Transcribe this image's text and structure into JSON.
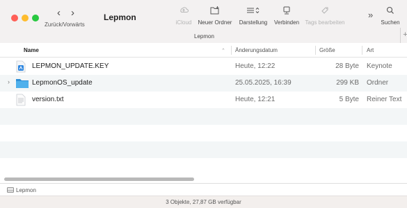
{
  "window": {
    "title": "Lepmon",
    "path_title": "Lepmon"
  },
  "toolbar": {
    "nav_label": "Zurück/Vorwärts",
    "back_icon": "chevron-left-icon",
    "forward_icon": "chevron-right-icon",
    "back_glyph": "‹",
    "forward_glyph": "›",
    "icloud_label": "iCloud",
    "new_folder_label": "Neuer Ordner",
    "view_label": "Darstellung",
    "connect_label": "Verbinden",
    "tags_label": "Tags bearbeiten",
    "more_glyph": "»",
    "search_label": "Suchen",
    "add_glyph": "+"
  },
  "columns": {
    "name": "Name",
    "sort_indicator": "⌃",
    "date": "Änderungsdatum",
    "size": "Größe",
    "kind": "Art"
  },
  "files": [
    {
      "name": "LEPMON_UPDATE.KEY",
      "date": "Heute, 12:22",
      "size": "28 Byte",
      "kind": "Keynote",
      "icon": "keynote-file-icon"
    },
    {
      "name": "LepmonOS_update",
      "date": "25.05.2025, 16:39",
      "size": "299 KB",
      "kind": "Ordner",
      "icon": "folder-icon",
      "disclosure": "›"
    },
    {
      "name": "version.txt",
      "date": "Heute, 12:21",
      "size": "5 Byte",
      "kind": "Reiner Text",
      "icon": "text-file-icon"
    }
  ],
  "bottom_path": {
    "label": "Lepmon"
  },
  "status": {
    "text": "3 Objekte, 27,87 GB verfügbar"
  },
  "colors": {
    "close": "#ff5f57",
    "minimize": "#febc2e",
    "zoom": "#28c840",
    "folder": "#3fa6e6",
    "keynote": "#2f87e0",
    "stripe": "#f3f6f7"
  }
}
